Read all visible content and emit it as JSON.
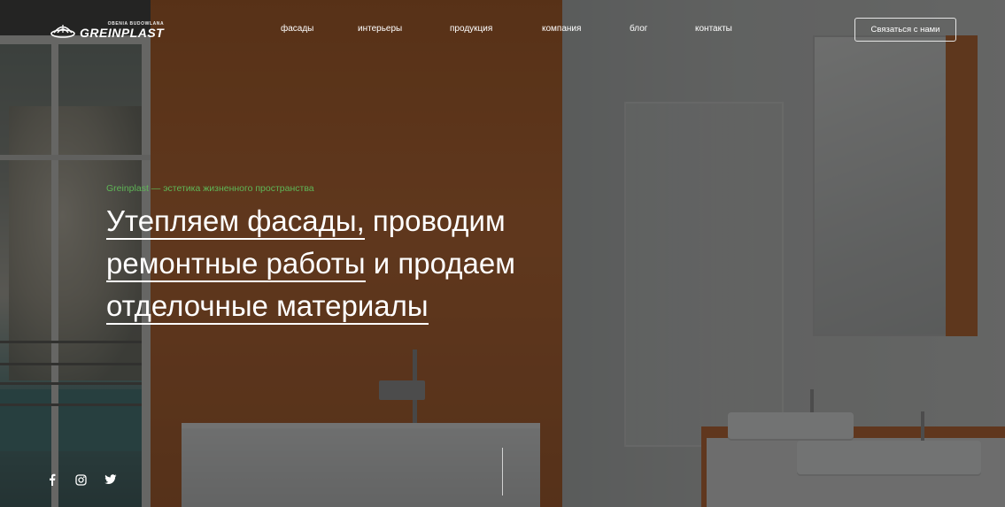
{
  "brand": {
    "name": "GREINPLAST",
    "subtitle": "OBENIA BUDOWLANA"
  },
  "nav": {
    "items": [
      {
        "label": "фасады"
      },
      {
        "label": "интерьеры"
      },
      {
        "label": "продукция"
      },
      {
        "label": "компания"
      },
      {
        "label": "блог"
      },
      {
        "label": "контакты"
      }
    ]
  },
  "header": {
    "contact_button": "Связаться с нами"
  },
  "hero": {
    "tagline": "Greinplast — эстетика жизненного пространства",
    "line1_underlined": "Утепляем фасады,",
    "line1_rest": " проводим",
    "line2_underlined": "ремонтные работы",
    "line2_rest": " и продаем",
    "line3_underlined": "отделочные материалы"
  },
  "socials": {
    "items": [
      "facebook-icon",
      "instagram-icon",
      "twitter-icon"
    ]
  },
  "colors": {
    "accent_green": "#5fb657",
    "overlay": "rgba(20,20,20,0.58)",
    "text": "#ffffff"
  }
}
